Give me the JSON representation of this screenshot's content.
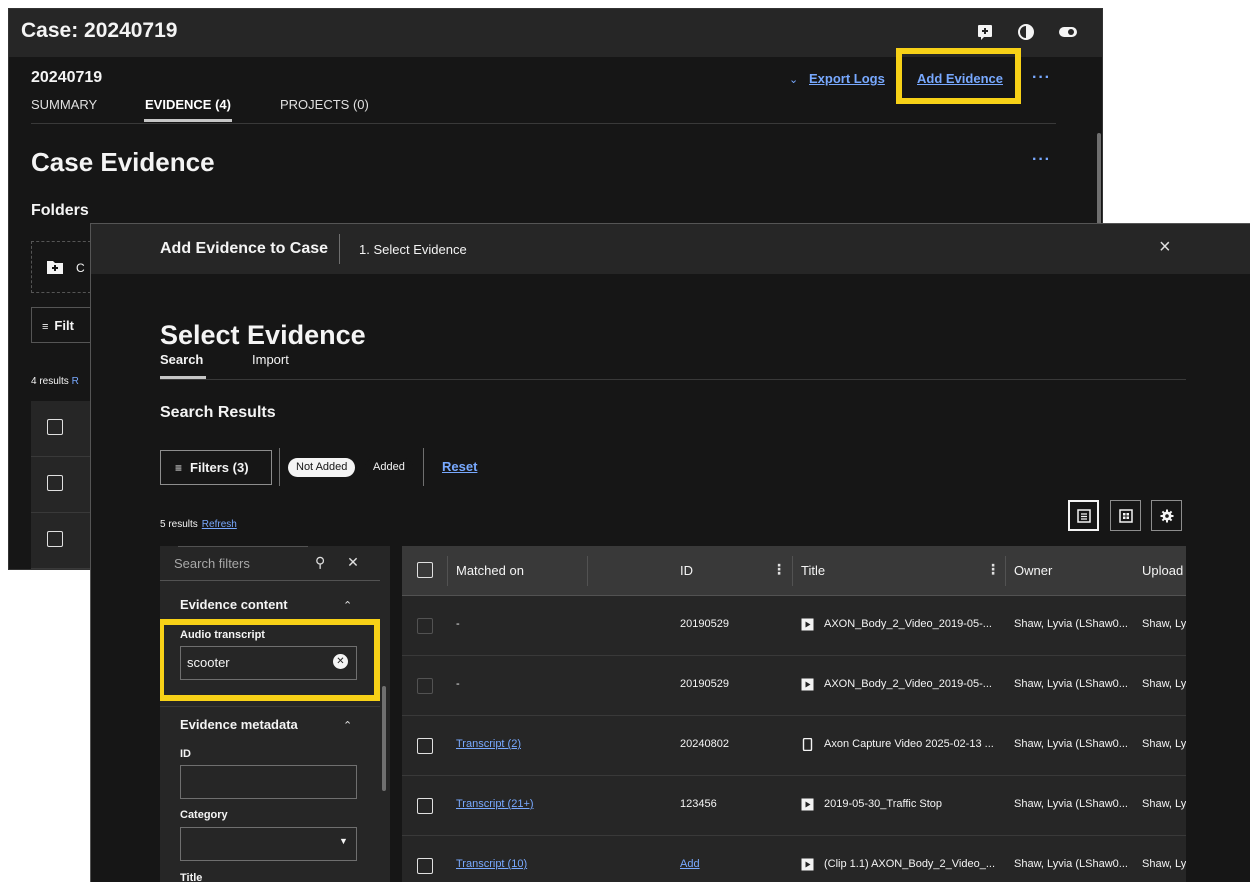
{
  "case_window": {
    "title": "Case: 20240719",
    "case_id": "20240719",
    "tabs": [
      "SUMMARY",
      "EVIDENCE (4)",
      "PROJECTS (0)"
    ],
    "export_logs": "Export Logs",
    "add_evidence": "Add Evidence",
    "more": "···",
    "heading": "Case Evidence",
    "folders": "Folders",
    "folder_card_text": "C",
    "filter_btn": "Filt",
    "results": "4 results",
    "results_link": "R",
    "highlight_color": "#f7d117"
  },
  "modal": {
    "title": "Add Evidence to Case",
    "step": "1. Select Evidence",
    "close": "×",
    "heading": "Select Evidence",
    "tabs": [
      "Search",
      "Import"
    ],
    "section": "Search Results",
    "filters_btn": "Filters (3)",
    "tag_not_added": "Not Added",
    "tag_added": "Added",
    "reset": "Reset",
    "results_count": "5 results",
    "refresh": "Refresh",
    "filter_panel": {
      "search_placeholder": "Search filters",
      "section_content": "Evidence content",
      "audio_label": "Audio transcript",
      "audio_value": "scooter",
      "section_metadata": "Evidence metadata",
      "id_label": "ID",
      "category_label": "Category",
      "title_label": "Title"
    },
    "table": {
      "headers": [
        "Matched on",
        "ID",
        "Title",
        "Owner",
        "Upload"
      ],
      "rows": [
        {
          "matched": "-",
          "id": "20190529",
          "title": "AXON_Body_2_Video_2019-05-...",
          "owner": "Shaw, Lyvia (LShaw0...",
          "upload": "Shaw, Ly",
          "icon": "video-icon",
          "disabled": true,
          "matched_link": false,
          "id_link": false
        },
        {
          "matched": "-",
          "id": "20190529",
          "title": "AXON_Body_2_Video_2019-05-...",
          "owner": "Shaw, Lyvia (LShaw0...",
          "upload": "Shaw, Ly",
          "icon": "video-icon",
          "disabled": true,
          "matched_link": false,
          "id_link": false
        },
        {
          "matched": "Transcript (2)",
          "id": "20240802",
          "title": "Axon Capture Video 2025-02-13 ...",
          "owner": "Shaw, Lyvia (LShaw0...",
          "upload": "Shaw, Ly",
          "icon": "phone-icon",
          "disabled": false,
          "matched_link": true,
          "id_link": false
        },
        {
          "matched": "Transcript (21+)",
          "id": "123456",
          "title": "2019-05-30_Traffic Stop",
          "owner": "Shaw, Lyvia (LShaw0...",
          "upload": "Shaw, Ly",
          "icon": "video-icon",
          "disabled": false,
          "matched_link": true,
          "id_link": false
        },
        {
          "matched": "Transcript (10)",
          "id": "Add",
          "title": "(Clip 1.1) AXON_Body_2_Video_...",
          "owner": "Shaw, Lyvia (LShaw0...",
          "upload": "Shaw, Ly",
          "icon": "video-icon",
          "disabled": false,
          "matched_link": true,
          "id_link": true
        }
      ]
    }
  }
}
